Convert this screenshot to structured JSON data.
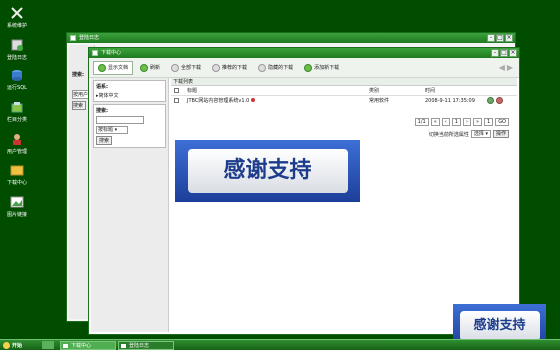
{
  "desktop": {
    "icons": [
      {
        "name": "system-maintenance",
        "label": "系统维护"
      },
      {
        "name": "login-log",
        "label": "登陆日志"
      },
      {
        "name": "run-sql",
        "label": "运行SQL"
      },
      {
        "name": "column-category",
        "label": "栏目分类"
      },
      {
        "name": "user-management",
        "label": "用户管理"
      },
      {
        "name": "download-center",
        "label": "下载中心"
      },
      {
        "name": "image-links",
        "label": "图片链接"
      }
    ]
  },
  "back_window": {
    "title": "登陆日志",
    "side_label": "搜索:",
    "side_button": "按用户",
    "side_button2": "搜索"
  },
  "front_window": {
    "title": "下载中心",
    "toolbar": [
      {
        "label": "显示文档",
        "active": true
      },
      {
        "label": "刷新"
      },
      {
        "label": "全部下载"
      },
      {
        "label": "推荐的下载"
      },
      {
        "label": "隐藏的下载"
      },
      {
        "label": "添加新下载"
      }
    ],
    "left": {
      "language_title": "语系:",
      "language_item": "▸简体中文",
      "search_title": "搜索:",
      "search_select": "按标题",
      "search_button": "搜索"
    },
    "content": {
      "header": "下载列表",
      "columns": {
        "title": "标题",
        "category": "类别",
        "time": "时间"
      },
      "rows": [
        {
          "title": "JTBC网站内容管理系统v1.0",
          "category": "常用软件",
          "time": "2008-9-11 17:35:09"
        }
      ],
      "pager": [
        "1/1",
        "«",
        "‹",
        "1",
        "›",
        "»",
        "1",
        "GO"
      ],
      "batch_label": "切换当前所选属性",
      "batch_select": "选择",
      "batch_button": "操作"
    }
  },
  "banners": {
    "main_text": "感谢支持",
    "corner_text": "感谢支持"
  },
  "taskbar": {
    "start_label": "开始",
    "tasks": [
      {
        "label": "下载中心",
        "active": true
      },
      {
        "label": "登陆日志",
        "active": false
      }
    ]
  },
  "colors": {
    "desktop_bg": "#004d00",
    "titlebar": "#2a8f2a",
    "banner_blue": "#2a55c0"
  }
}
